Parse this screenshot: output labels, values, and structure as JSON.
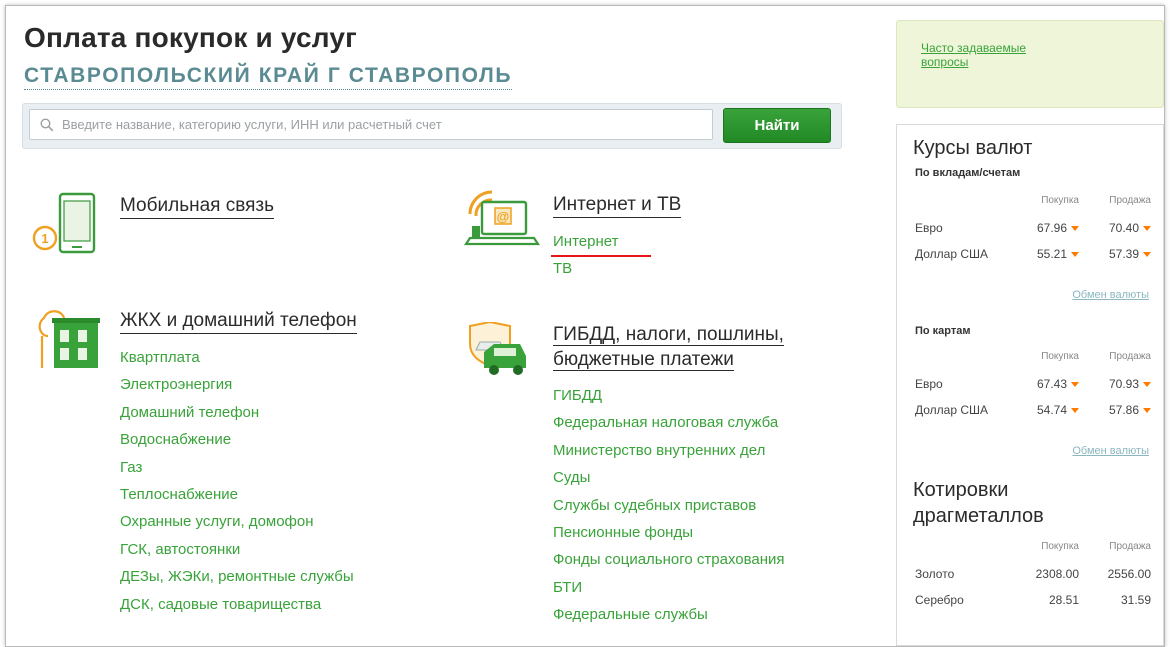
{
  "header": {
    "title": "Оплата покупок и услуг",
    "region": "СТАВРОПОЛЬСКИЙ КРАЙ Г СТАВРОПОЛЬ"
  },
  "search": {
    "placeholder": "Введите название, категорию услуги, ИНН или расчетный счет",
    "button_label": "Найти"
  },
  "categories": {
    "mobile": {
      "title": "Мобильная связь",
      "links": []
    },
    "internet": {
      "title": "Интернет и ТВ",
      "links": [
        "Интернет",
        "ТВ"
      ]
    },
    "housing": {
      "title": "ЖКХ и домашний телефон",
      "links": [
        "Квартплата",
        "Электроэнергия",
        "Домашний телефон",
        "Водоснабжение",
        "Газ",
        "Теплоснабжение",
        "Охранные услуги, домофон",
        "ГСК, автостоянки",
        "ДЕЗы, ЖЭКи, ремонтные службы",
        "ДСК, садовые товарищества"
      ]
    },
    "taxes": {
      "title_line1": "ГИБДД, налоги, пошлины,",
      "title_line2": "бюджетные платежи",
      "links": [
        "ГИБДД",
        "Федеральная налоговая служба",
        "Министерство внутренних дел",
        "Суды",
        "Службы судебных приставов",
        "Пенсионные фонды",
        "Фонды социального страхования",
        "БТИ",
        "Федеральные службы"
      ]
    }
  },
  "sidebar": {
    "faq": "Часто задаваемые вопросы",
    "rates_title": "Курсы валют",
    "deposits_label": "По вкладам/счетам",
    "cards_label": "По картам",
    "buy_label": "Покупка",
    "sell_label": "Продажа",
    "exchange_link": "Обмен валюты",
    "deposit_rates": [
      {
        "name": "Евро",
        "buy": "67.96",
        "sell": "70.40"
      },
      {
        "name": "Доллар США",
        "buy": "55.21",
        "sell": "57.39"
      }
    ],
    "card_rates": [
      {
        "name": "Евро",
        "buy": "67.43",
        "sell": "70.93"
      },
      {
        "name": "Доллар США",
        "buy": "54.74",
        "sell": "57.86"
      }
    ],
    "metals_title_line1": "Котировки",
    "metals_title_line2": "драгметаллов",
    "metals": [
      {
        "name": "Золото",
        "buy": "2308.00",
        "sell": "2556.00"
      },
      {
        "name": "Серебро",
        "buy": "28.51",
        "sell": "31.59"
      }
    ]
  },
  "colors": {
    "accent_green": "#39a33a",
    "region_teal": "#5a8a92",
    "arrow_orange": "#ff7a00",
    "highlight_red": "#e8141b"
  }
}
